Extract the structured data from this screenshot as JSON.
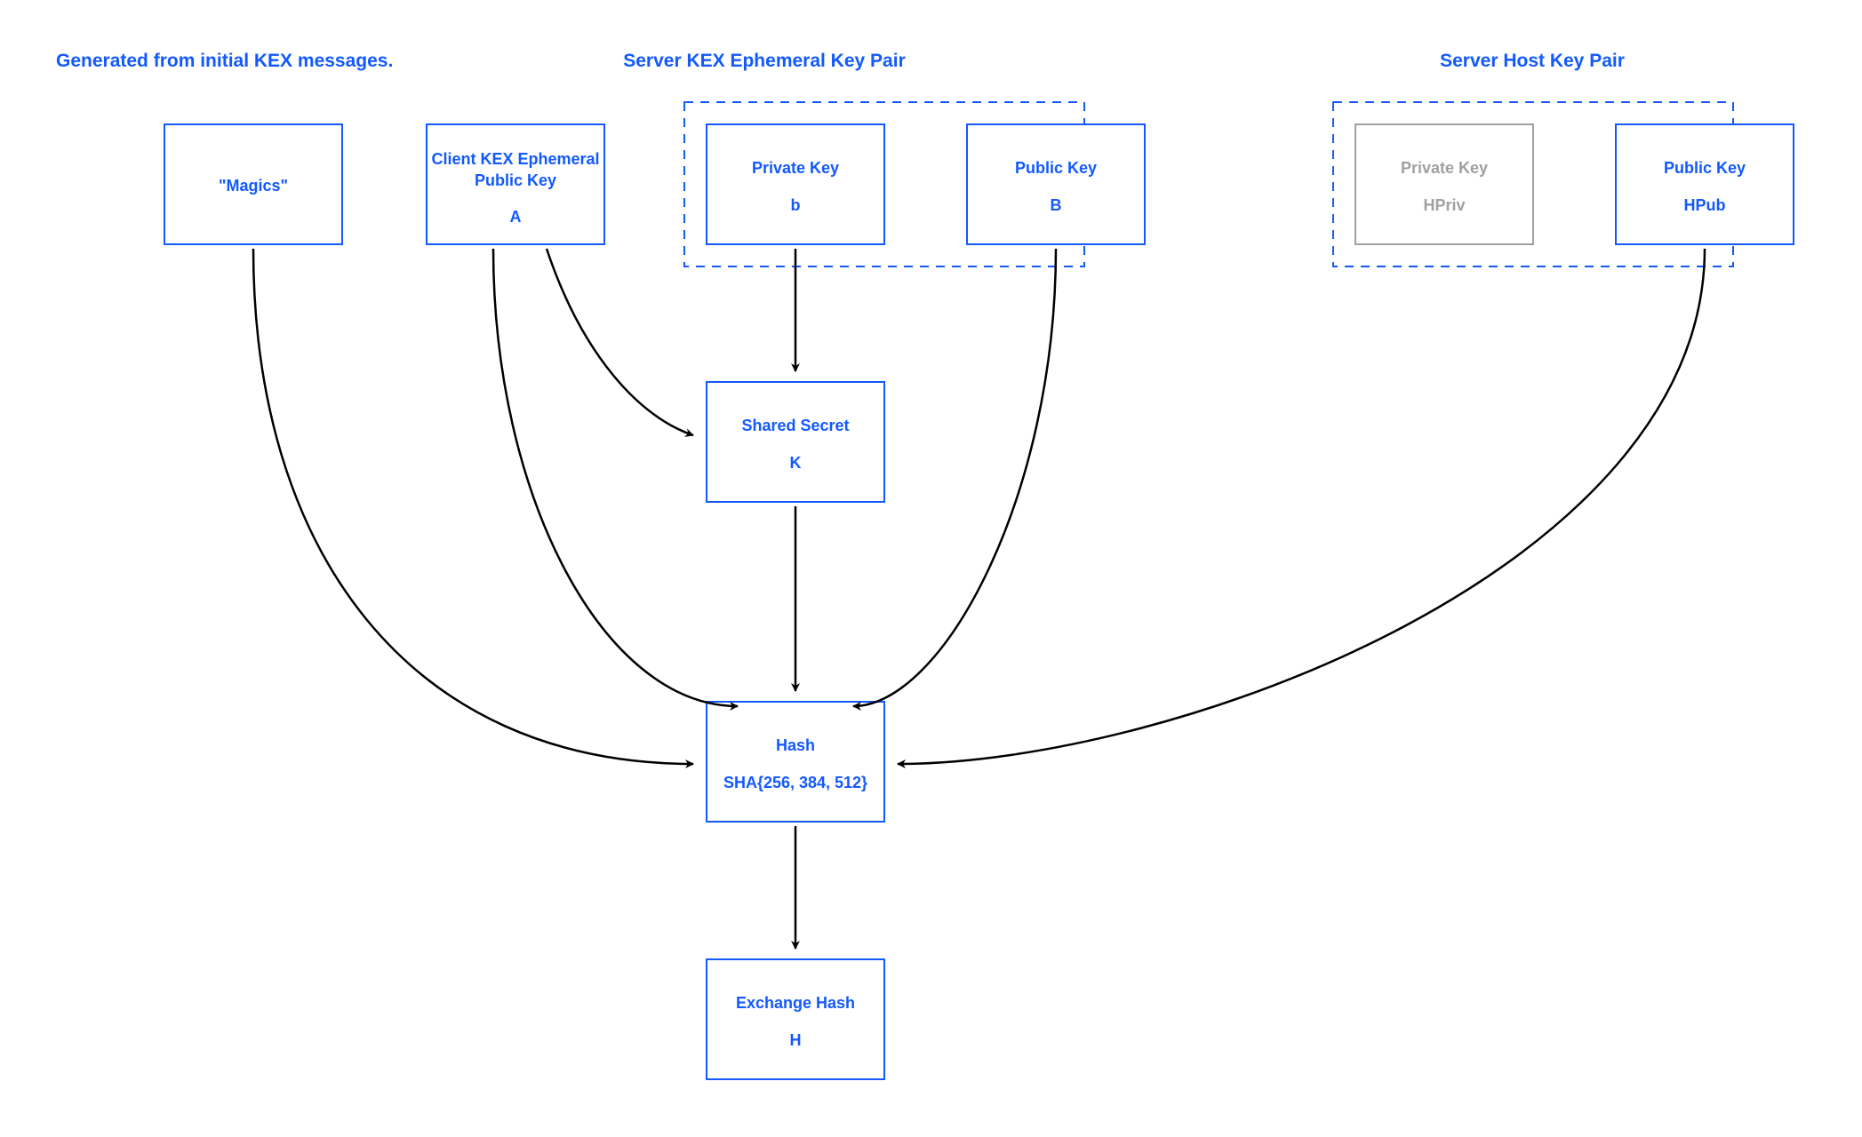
{
  "headings": {
    "generated": "Generated from initial KEX messages.",
    "server_kex": "Server KEX Ephemeral Key Pair",
    "server_host": "Server Host Key Pair"
  },
  "boxes": {
    "magics": {
      "title": "\"Magics\"",
      "sub": ""
    },
    "client_kex": {
      "title": "Client KEX Ephemeral",
      "title2": "Public Key",
      "sub": "A"
    },
    "priv_key_b": {
      "title": "Private Key",
      "sub": "b"
    },
    "pub_key_B": {
      "title": "Public Key",
      "sub": "B"
    },
    "hpriv": {
      "title": "Private Key",
      "sub": "HPriv"
    },
    "hpub": {
      "title": "Public Key",
      "sub": "HPub"
    },
    "shared_secret": {
      "title": "Shared Secret",
      "sub": "K"
    },
    "hash": {
      "title": "Hash",
      "sub": "SHA{256, 384, 512}"
    },
    "exchange_hash": {
      "title": "Exchange Hash",
      "sub": "H"
    }
  }
}
